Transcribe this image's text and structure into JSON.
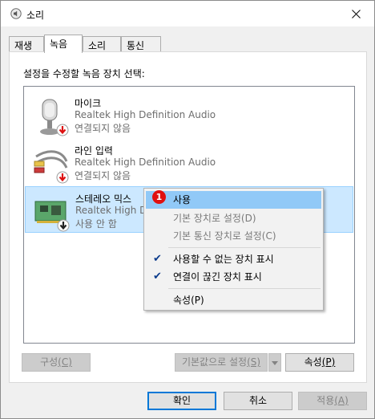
{
  "window": {
    "title": "소리"
  },
  "tabs": [
    {
      "label": "재생"
    },
    {
      "label": "녹음"
    },
    {
      "label": "소리"
    },
    {
      "label": "통신"
    }
  ],
  "panel": {
    "instruction": "설정을 수정할 녹음 장치 선택:"
  },
  "devices": [
    {
      "name": "마이크",
      "driver": "Realtek High Definition Audio",
      "status": "연결되지 않음"
    },
    {
      "name": "라인 입력",
      "driver": "Realtek High Definition Audio",
      "status": "연결되지 않음"
    },
    {
      "name": "스테레오 믹스",
      "driver": "Realtek High De",
      "status": "사용 안 함"
    }
  ],
  "context_menu": {
    "items": [
      {
        "label": "사용"
      },
      {
        "label": "기본 장치로 설정(D)"
      },
      {
        "label": "기본 통신 장치로 설정(C)"
      },
      {
        "label": "사용할 수 없는 장치 표시"
      },
      {
        "label": "연결이 끊긴 장치 표시"
      },
      {
        "label": "속성(P)"
      }
    ]
  },
  "step_badge": "1",
  "buttons": {
    "configure": "구성",
    "configure_key": "(C)",
    "set_default": "기본값으로 설정",
    "set_default_key": "(S)",
    "properties": "속성",
    "properties_key": "(P)",
    "ok": "확인",
    "cancel": "취소",
    "apply": "적용",
    "apply_key": "(A)"
  },
  "icons": {
    "title": "speaker-icon",
    "close": "close-icon",
    "status_down": "red-down-arrow-icon",
    "check": "checkmark-icon"
  },
  "colors": {
    "selection": "#cce8ff",
    "menu_highlight": "#91c9f7",
    "default_border": "#0078d7",
    "badge": "#e01010"
  }
}
